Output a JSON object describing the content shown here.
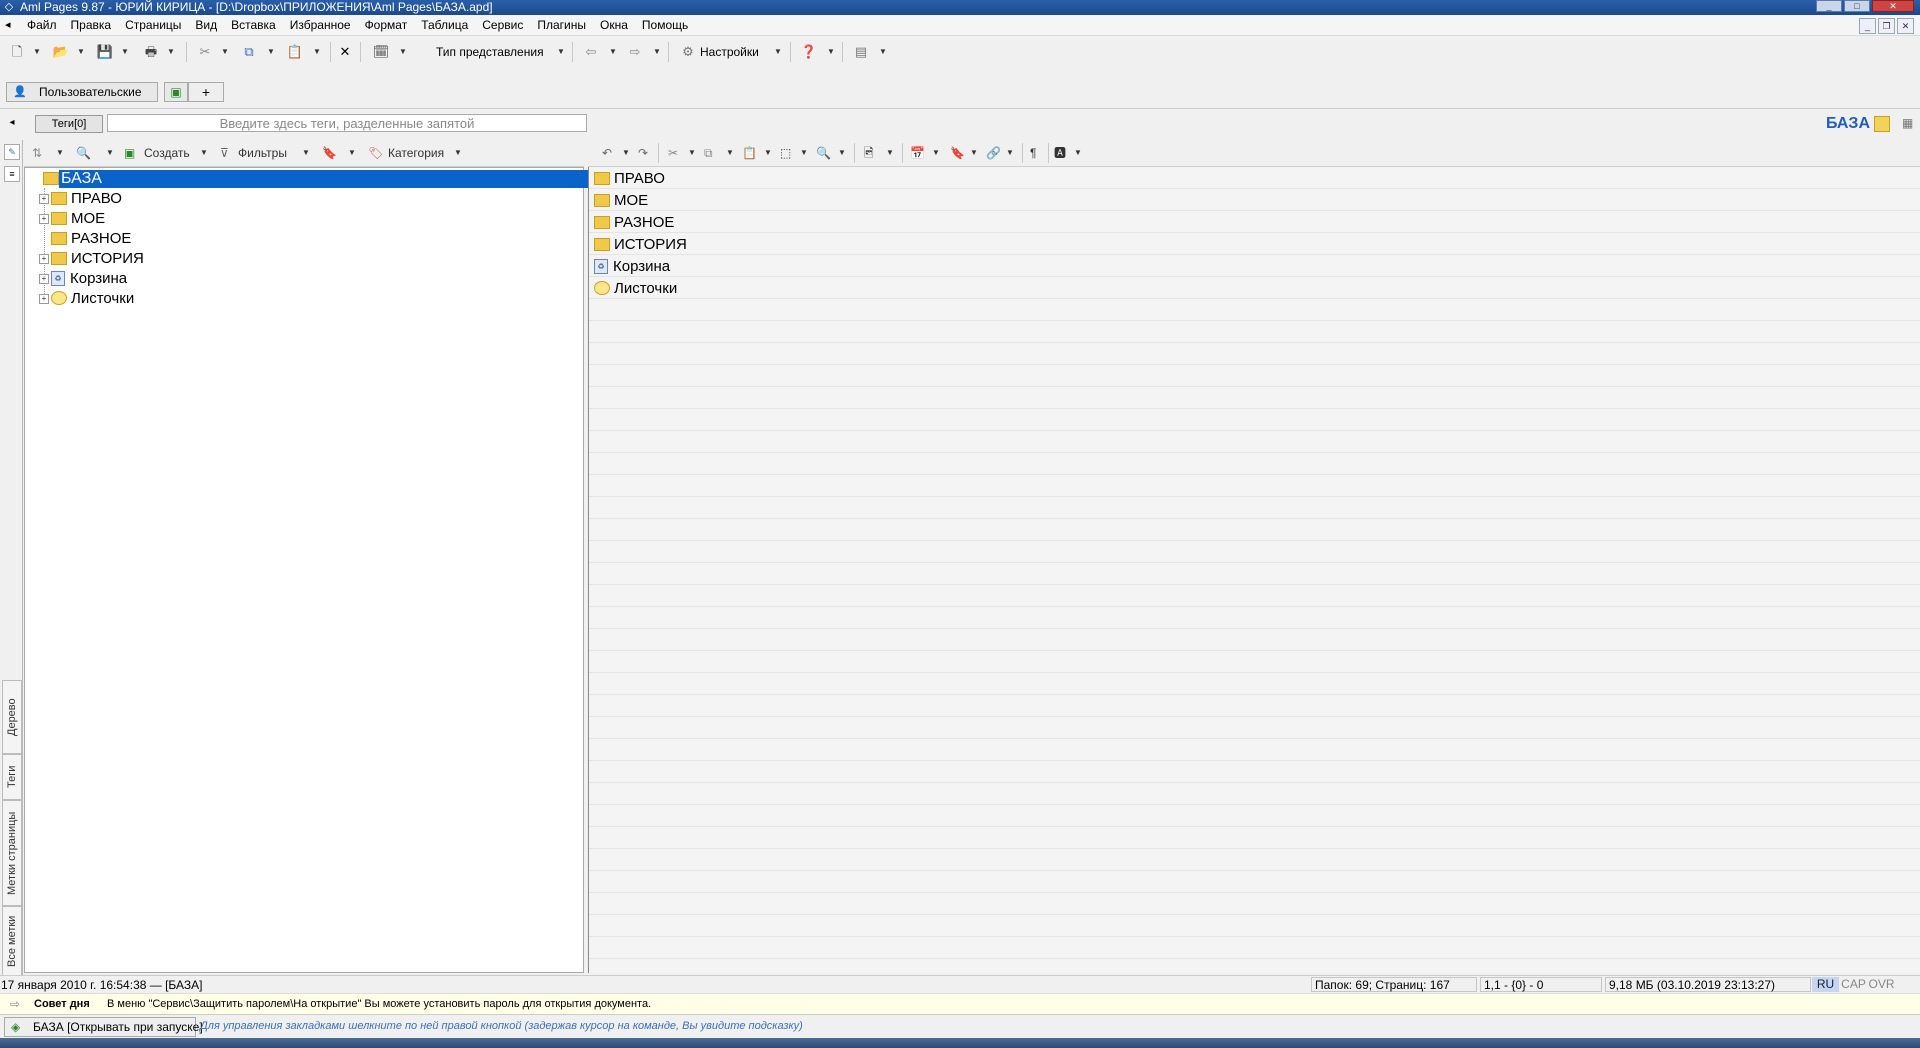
{
  "window": {
    "title": "Aml Pages 9.87 - ЮРИЙ КИРИЦА - [D:\\Dropbox\\ПРИЛОЖЕНИЯ\\Aml Pages\\БАЗА.apd]"
  },
  "menu": [
    "Файл",
    "Правка",
    "Страницы",
    "Вид",
    "Вставка",
    "Избранное",
    "Формат",
    "Таблица",
    "Сервис",
    "Плагины",
    "Окна",
    "Помощь"
  ],
  "toolbar": {
    "view_type_label": "Тип представления",
    "settings_label": "Настройки"
  },
  "bookmarks": {
    "tab_label": "Пользовательские",
    "plus_label": "+"
  },
  "tags": {
    "button_label": "Теги[0]",
    "placeholder": "Введите здесь теги, разделенные запятой",
    "base_label": "БАЗА"
  },
  "vertical_tabs": [
    "Дерево",
    "Теги",
    "Метки страницы",
    "Все метки"
  ],
  "left_toolbar": {
    "create_label": "Создать",
    "filters_label": "Фильтры",
    "category_label": "Категория"
  },
  "tree": {
    "root": "БАЗА",
    "children": [
      {
        "label": "ПРАВО",
        "icon": "folder-icon",
        "expandable": true
      },
      {
        "label": "МОЕ",
        "icon": "folder-icon",
        "expandable": true
      },
      {
        "label": "РАЗНОЕ",
        "icon": "folder-icon",
        "expandable": false
      },
      {
        "label": "ИСТОРИЯ",
        "icon": "folder-icon",
        "expandable": true
      },
      {
        "label": "Корзина",
        "icon": "recycle-bin-icon",
        "expandable": true
      },
      {
        "label": "Листочки",
        "icon": "notes-icon",
        "expandable": true
      }
    ]
  },
  "content_items": [
    {
      "label": "ПРАВО",
      "icon": "folder-icon"
    },
    {
      "label": "МОЕ",
      "icon": "folder-icon"
    },
    {
      "label": "РАЗНОЕ",
      "icon": "folder-icon"
    },
    {
      "label": "ИСТОРИЯ",
      "icon": "folder-icon"
    },
    {
      "label": "Корзина",
      "icon": "recycle-bin-icon"
    },
    {
      "label": "Листочки",
      "icon": "notes-icon"
    }
  ],
  "status": {
    "date": "17 января 2010 г. 16:54:38 — [БАЗА]",
    "counts": "Папок: 69; Страниц: 167",
    "position": "1,1 - {0} - 0",
    "size": "9,18 МБ (03.10.2019 23:13:27)",
    "lang": "RU",
    "cap": "CAP",
    "ovr": "OVR"
  },
  "tip": {
    "title": "Совет дня",
    "text": "В меню \"Сервис\\Защитить паролем\\На открытие\" Вы можете установить пароль для открытия документа."
  },
  "bottom": {
    "bookmark_label": "БАЗА [Открывать при запуске]",
    "hint": "Для управления закладками шелкните по ней правой кнопкой (задержав курсор на команде, Вы увидите подсказку)"
  }
}
